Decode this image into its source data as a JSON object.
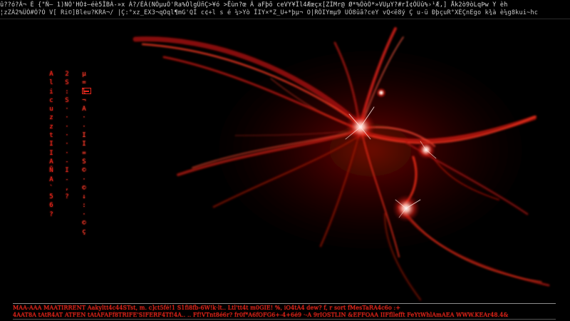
{
  "top_ticker": {
    "row1": "û??ó?Ã¬ È {\"Ñ— 1)NÒ'HÓ‡—éè5ÎBÁ-»x À?/ÈÁ(NÕµuÔ'Ra%ÔlgÜñÇ>¥ó >Ëùn?œ Â aFþõ ceVY¥Îl4Æœçx[ZÌMr@ Ø*%ÔòÖ*»VUµY?#rÌ¢ÕÜû%›¹Æ,] Åk2ò9òLqÞw Y èh",
    "row2": "¦zZÁ2%ÜÒ#Ò?Ò V[ Ri©]Bleu?KRA¬/ |Ç:°xz_EX3¬qOql¶mG'QÎ c¢+l s é ¼>Yò ÎIY×*Z_U+*þµ¬ O|RÔIYmµ9 UÕ8ûã?ceY vQ<ë8ý Ç u-ü ÐþçuR°XÈÇnEgo k¾à è¼g8kui~hc"
  },
  "left_columns": {
    "col1": "A\nl\ni\nc\nu\nz\nz\nt\nI\nI\nA\nÑ\nA\n`\n5\n6\n?",
    "col2": "2\nS\n:\nS\n·\n·\n·\n·\n·\n·\n-\nI\n-\n,\n?",
    "col3": "µ\n=\nl\n¬\nA\n·\n·\nI\nI\n=\nS\n©\n·\n©\n↓\n:\n·\n©\nç"
  },
  "bottom_ticker": {
    "row1": "MAA-AAA MAATIRRENT Aakyltt4c44STst, m. c]ct5fé!1 S1fi8fb-6W!k·lt.. Ltl'tt4t m0GIE! %, iO4tÀ4 dew? f, r sort fMesTaRA4c6o :+",
    "row2": "4AAT8A tAtR4AT ATFEN tAtÀFAFf8TRIFE'SIFERF4Tf!4Ä.. .. Ff!VTnt8é6r? fr0f*A6fOFG6+-4+6é9 ·-A 9rIOSTLIN &EFFOAA IIFfllefft FeYtWhlAmAEA WWW.KEAr48.4&"
  },
  "colors": {
    "accent_red": "#e8251b",
    "ticker_white": "#d8d8d8",
    "background": "#000000"
  },
  "icons": {
    "selection_marker": "selected-item-marker"
  }
}
